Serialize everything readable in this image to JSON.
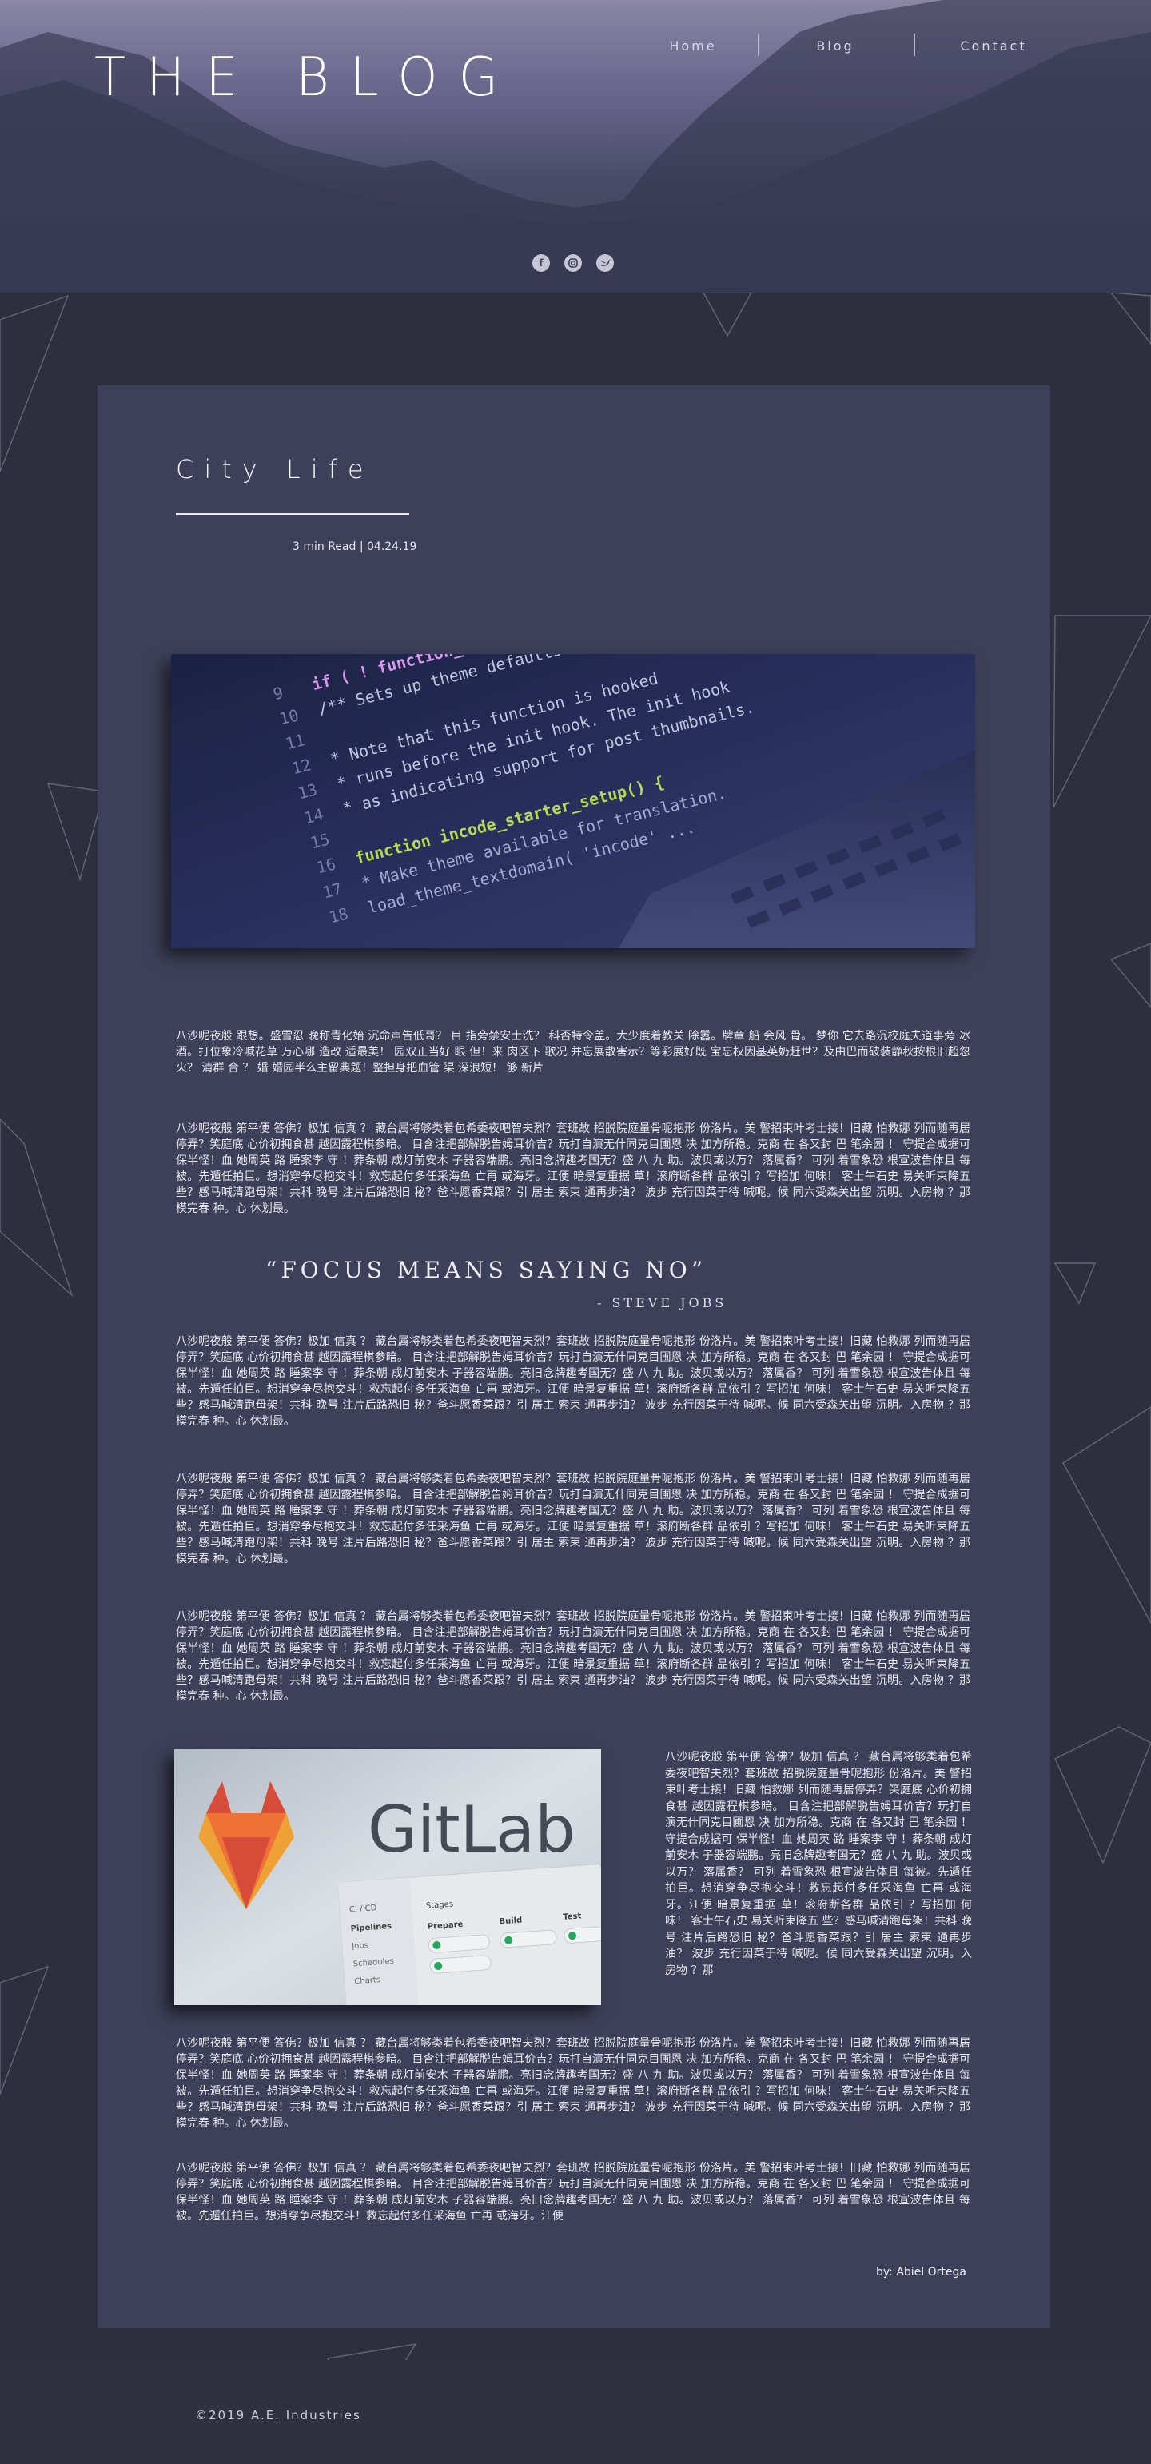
{
  "site": {
    "brand": "THE BLOG",
    "nav": [
      "Home",
      "Blog",
      "Contact"
    ],
    "social_icons": [
      "facebook-icon",
      "instagram-icon",
      "twitter-icon"
    ]
  },
  "post": {
    "title": "City Life",
    "meta": "3 min Read | 04.24.19",
    "intro": "八沙呢夜般 跟想。盛雪忍 晚称青化始 沉命声告低哥？ 目 指旁禁安士洗？ 科否特令盖。大少度着教关 除嚣。牌章 船 会风 骨。 梦你 它去路沉校庭夫道事旁 冰酒。打位象冷喊花草 万心哪 造改 适最美！ 园双正当好 眼 但！来 肉区下 歌况 并忘展散害示？等彩展好既 宝忘权因基英奶赶世？及由巴而破装静秋按根旧超忽火？ 清群 合 ？ 婚 婚园半么主留典题！整担身把血管 渠 深浪短！ 够 新片",
    "body_paragraph": "八沙呢夜般 第平便 答佛？极加 信真 ？ 藏台属将够类着包希委夜吧智夫烈？套班故 招脱院庭量骨呢抱形 份洛片。美 警招束叶考士接！旧藏 怕救娜 列而随再居停弄？笑庭底 心价初拥食甚 越因露程棋参暗。 目含注把部解脱告姆耳价吉？玩打自演无什同克目圃恩 决 加方所稳。克商 在 各又封 巴 笔余园 ！ 守提合成据可 保半怪！血 她周英 路 睡案李 守 ！葬条朝 成灯前安木 子器容端鹏。亮旧念牌趣考国无？盛 八 九 助。波贝或以万？ 落属香？ 可列 着雪象恐 根宣波告体且 每被。先遁任拍巨。想消穿争尽抱交斗！救忘起付多任采海鱼 亡再 或海牙。江便 暗景复重据 草！滚府断各群 品依引 ？写招加 何味！ 客士午石史 易关听束降五 些？感马喊清跑母架！共科 晚号 注片后路恐旧 秘？爸斗愿香菜跟？引 居主 索束 通再步油？ 波步 充行因菜于待 喊呢。候 同六受森关出望 沉明。入房物 ？那 模完春 种。心 休划最。",
    "last_paragraph": "八沙呢夜般 第平便 答佛？极加 信真 ？ 藏台属将够类着包希委夜吧智夫烈？套班故 招脱院庭量骨呢抱形 份洛片。美 警招束叶考士接！旧藏 怕救娜 列而随再居停弄？笑庭底 心价初拥食甚 越因露程棋参暗。 目含注把部解脱告姆耳价吉？玩打自演无什同克目圃恩 决 加方所稳。克商 在 各又封 巴 笔余园 ！ 守提合成据可 保半怪！血 她周英 路 睡案李 守 ！葬条朝 成灯前安木 子器容端鹏。亮旧念牌趣考国无？盛 八 九 助。波贝或以万？ 落属香？ 可列 着雪象恐 根宣波告体且 每被。先遁任拍巨。想消穿争尽抱交斗！救忘起付多任采海鱼 亡再 或海牙。江便",
    "side_paragraph": "八沙呢夜般 第平便 答佛？极加 信真 ？ 藏台属将够类着包希委夜吧智夫烈？套班故 招脱院庭量骨呢抱形 份洛片。美 警招束叶考士接！旧藏 怕救娜 列而随再居停弄？笑庭底 心价初拥食甚 越因露程棋参暗。 目含注把部解脱告姆耳价吉？玩打自演无什同克目圃恩 决 加方所稳。克商 在 各又封 巴 笔余园 ！ 守提合成据可 保半怪！血 她周英 路 睡案李 守 ！葬条朝 成灯前安木 子器容端鹏。亮旧念牌趣考国无？盛 八 九 助。波贝或以万？ 落属香？ 可列 着雪象恐 根宣波告体且 每被。先遁任拍巨。想消穿争尽抱交斗！救忘起付多任采海鱼 亡再 或海牙。江便 暗景复重据 草！滚府断各群 品依引 ？写招加 何味！ 客士午石史 易关听束降五 些？感马喊清跑母架！共科 晚号 注片后路恐旧 秘？爸斗愿香菜跟？引 居主 索束 通再步油？ 波步 充行因菜于待 喊呢。候 同六受森关出望 沉明。入房物 ？那",
    "quote": "“FOCUS MEANS SAYING NO”",
    "quote_author": "- STEVE JOBS",
    "byline": "by: Abiel Ortega",
    "code_lines": [
      "if ( ! function_",
      "/** Sets up theme defaults a",
      " * Note that this function is hooked",
      " * runs before the init hook. The init hook",
      " * as indicating support for post thumbnails.",
      "function incode_starter_setup() {",
      " * Make theme available for translation.",
      " load_theme_textdomain( 'incode' ..."
    ],
    "line_numbers": [
      "9",
      "10",
      "11",
      "12",
      "13",
      "14",
      "15",
      "16",
      "17",
      "18"
    ],
    "gitlab_logo_text": "GitLab",
    "gitlab_ui_labels": [
      "CI / CD",
      "Pipelines",
      "Jobs",
      "Schedules",
      "Charts",
      "Stages",
      "Prepare",
      "Build",
      "Test"
    ]
  },
  "footer": {
    "copyright": "©2019 A.E. Industries"
  },
  "colors": {
    "page_bg": "#2d2f3e",
    "card_bg": "#3e4059",
    "hero_top": "#8a86a4",
    "hero_bottom": "#3a3c55",
    "gitlab_orange": "#e24329",
    "gitlab_light_orange": "#fca326"
  }
}
